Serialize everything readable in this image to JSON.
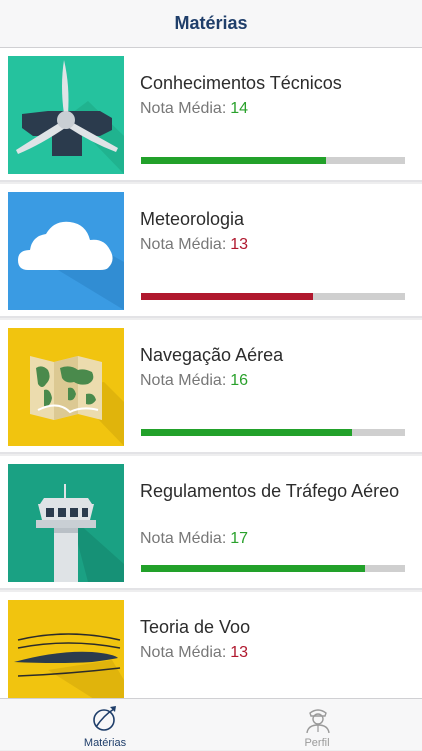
{
  "header": {
    "title": "Matérias"
  },
  "subjects": [
    {
      "title": "Conhecimentos Técnicos",
      "grade_label": "Nota Média:",
      "grade": "14",
      "grade_color": "#2aa12c",
      "progress": 0.7,
      "bar_color": "#22a12a",
      "icon": "propeller-icon",
      "tile_color": "#25c29e"
    },
    {
      "title": "Meteorologia",
      "grade_label": "Nota Média:",
      "grade": "13",
      "grade_color": "#b0182e",
      "progress": 0.65,
      "bar_color": "#b0182e",
      "icon": "cloud-icon",
      "tile_color": "#3a9be3"
    },
    {
      "title": "Navegação Aérea",
      "grade_label": "Nota Média:",
      "grade": "16",
      "grade_color": "#2aa12c",
      "progress": 0.8,
      "bar_color": "#22a12a",
      "icon": "world-map-icon",
      "tile_color": "#f1c40f"
    },
    {
      "title": "Regulamentos de Tráfego Aéreo",
      "grade_label": "Nota Média:",
      "grade": "17",
      "grade_color": "#2aa12c",
      "progress": 0.85,
      "bar_color": "#22a12a",
      "icon": "control-tower-icon",
      "tile_color": "#1aa183"
    },
    {
      "title": "Teoria de Voo",
      "grade_label": "Nota Média:",
      "grade": "13",
      "grade_color": "#b0182e",
      "progress": 0.65,
      "bar_color": "#b0182e",
      "icon": "airfoil-icon",
      "tile_color": "#f1c40f"
    }
  ],
  "tabbar": {
    "tabs": [
      {
        "label": "Matérias",
        "icon": "airplane-globe-icon",
        "active": true
      },
      {
        "label": "Perfil",
        "icon": "pilot-profile-icon",
        "active": false
      }
    ]
  }
}
